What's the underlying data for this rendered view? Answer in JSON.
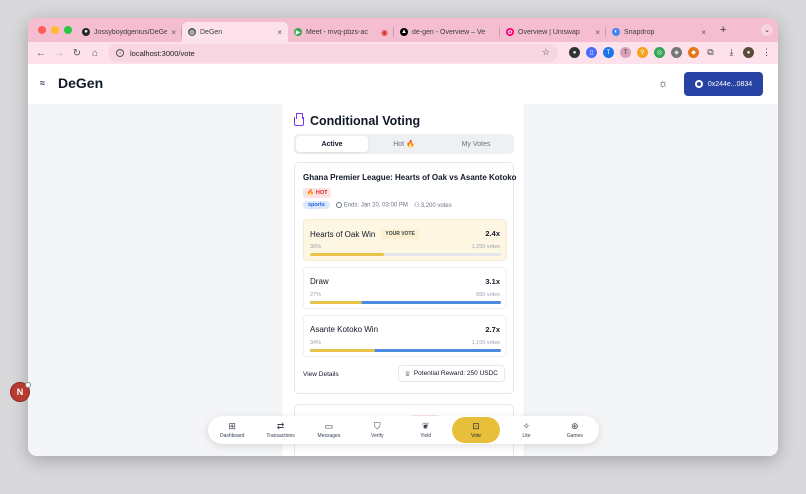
{
  "browser": {
    "tabs": [
      {
        "title": "Jossyboydgenius/DeGen",
        "favicon": "github-icon",
        "color": "#24292f"
      },
      {
        "title": "DeGen",
        "favicon": "globe-icon",
        "color": "#5f6368",
        "active": true
      },
      {
        "title": "Meet - mvq-pbzs-ac",
        "favicon": "meet-icon",
        "color": "#34a853"
      },
      {
        "title": "de-gen - Overview – Ve",
        "favicon": "vercel-icon",
        "color": "#000000"
      },
      {
        "title": "Overview | Uniswap",
        "favicon": "uniswap-icon",
        "color": "#ff007a"
      },
      {
        "title": "Snapdrop",
        "favicon": "snapdrop-icon",
        "color": "#4285f4"
      }
    ],
    "new_tab": "+",
    "tab_close": "×",
    "url": "localhost:3000/vote"
  },
  "app": {
    "logo": "DeGen",
    "wallet_label": "0x244e...0834"
  },
  "vote": {
    "title": "Conditional Voting",
    "tabs": [
      {
        "label": "Active",
        "active": true
      },
      {
        "label": "Hot 🔥"
      },
      {
        "label": "My Votes"
      }
    ],
    "card": {
      "title": "Ghana Premier League: Hearts of Oak vs Asante Kotoko",
      "hot_badge": "HOT",
      "category": "sports",
      "ends": "Ends: Jan 20, 03:00 PM",
      "votes_total": "3,200 votes",
      "options": [
        {
          "name": "Hearts of Oak Win",
          "your_vote": "YOUR VOTE",
          "multiplier": "2.4x",
          "percent_label": "39%",
          "votes": "1,250 votes",
          "percent": 0.39,
          "voted": true
        },
        {
          "name": "Draw",
          "multiplier": "3.1x",
          "percent_label": "27%",
          "votes": "850 votes",
          "percent": 0.27
        },
        {
          "name": "Asante Kotoko Win",
          "multiplier": "2.7x",
          "percent_label": "34%",
          "votes": "1,100 votes",
          "percent": 0.34
        }
      ],
      "view_details": "View Details",
      "reward": "Potential Reward: 250 USDC"
    }
  },
  "bottom_nav": [
    {
      "label": "Dashboard",
      "icon": "grid-icon"
    },
    {
      "label": "Transactions",
      "icon": "swap-icon"
    },
    {
      "label": "Messages",
      "icon": "message-icon"
    },
    {
      "label": "Verify",
      "icon": "shield-icon"
    },
    {
      "label": "Yield",
      "icon": "leaf-icon"
    },
    {
      "label": "Vote",
      "icon": "ballot-icon",
      "active": true
    },
    {
      "label": "Lite",
      "icon": "sparkles-icon"
    },
    {
      "label": "Games",
      "icon": "gamepad-icon"
    }
  ],
  "avatar_letter": "N",
  "colors": {
    "accent": "#2743a3",
    "vote_active": "#e7bf3a",
    "bar_yellow": "#e7c34a",
    "bar_blue": "#4a8be0",
    "hot": "#dc2626"
  }
}
